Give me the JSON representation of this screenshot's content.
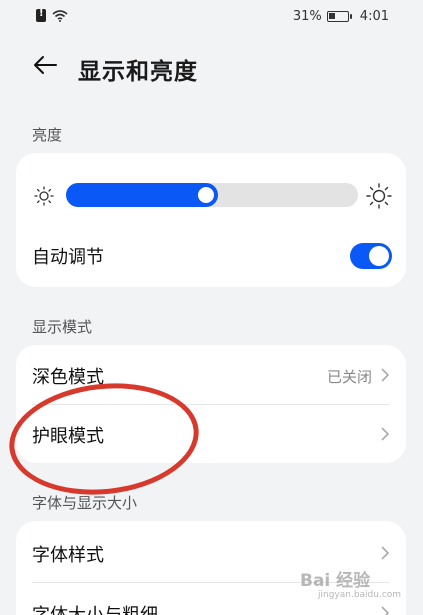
{
  "status_bar": {
    "battery": "31%",
    "time": "4:01"
  },
  "header": {
    "title": "显示和亮度"
  },
  "brightness": {
    "section_label": "亮度",
    "level": 0.52,
    "auto_label": "自动调节",
    "auto_enabled": true
  },
  "display_mode": {
    "section_label": "显示模式",
    "dark_mode_label": "深色模式",
    "dark_mode_value": "已关闭",
    "eye_comfort_label": "护眼模式"
  },
  "font_display": {
    "section_label": "字体与显示大小",
    "font_style_label": "字体样式",
    "font_size_label": "字体大小与粗细"
  },
  "watermark": {
    "brand": "Bai 经验",
    "url": "jingyan.baidu.com"
  },
  "colors": {
    "accent": "#0a59f7",
    "annotation": "#d73a2c",
    "background": "#f1f3f5"
  }
}
